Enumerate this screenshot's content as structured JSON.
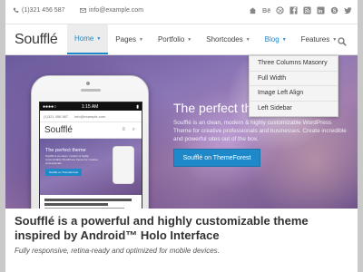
{
  "topbar": {
    "phone": "(1)321 456 587",
    "email": "info@example.com",
    "social_icons": [
      "house-icon",
      "behance-icon",
      "dribbble-icon",
      "facebook-icon",
      "rss-icon",
      "linkedin-icon",
      "skype-icon",
      "twitter-icon"
    ]
  },
  "header": {
    "logo": "Soufflé",
    "nav": [
      "Home",
      "Pages",
      "Portfolio",
      "Shortcodes",
      "Blog",
      "Features"
    ],
    "active_nav": "Home",
    "open_nav": "Blog"
  },
  "dropdown": {
    "items": [
      "Three Columns Masonry",
      "Full Width",
      "Image Left Align",
      "Left Sidebar"
    ]
  },
  "hero": {
    "title": "The perfect the",
    "text": "Soufflé is an clean, modern & highly customizable WordPress Theme for creative professionals and businesses. Create incredible and powerful sites out of the box.",
    "button": "Soufflé on ThemeForest"
  },
  "phone": {
    "carrier": "●●●●○",
    "time": "1:15 AM",
    "battery": "▮",
    "phone_number": "(1)321 456 587",
    "email": "info@example.com",
    "logo": "Soufflé",
    "header_icons": "≡ ⌕",
    "hero_title": "The perfect theme",
    "hero_text": "Soufflé is an clean, modern & highly customizable WordPress theme for creative professionals.",
    "hero_button": "Soufflé on ThemeForest"
  },
  "content": {
    "title": "Soufflé is a powerful and highly customizable theme inspired by Android™ Holo Interface",
    "subtitle": "Fully responsive, retina-ready and optimized for mobile devices."
  },
  "colors": {
    "accent": "#1f88c9",
    "text": "#333333"
  }
}
